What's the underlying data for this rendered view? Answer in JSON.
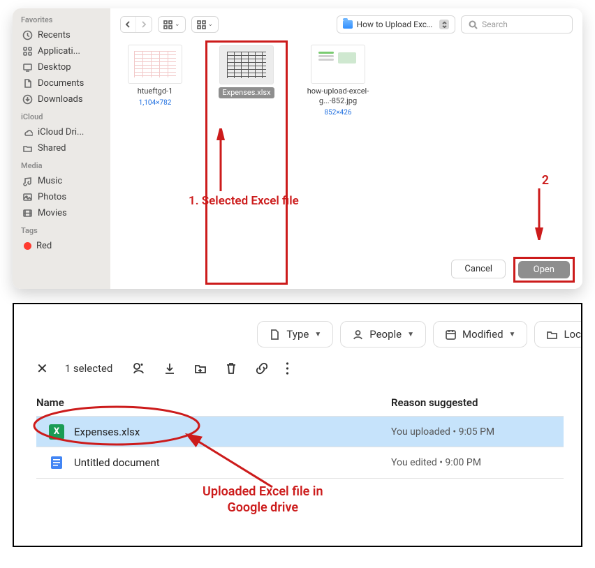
{
  "finder": {
    "sidebar": {
      "favorites_label": "Favorites",
      "items_fav": [
        {
          "icon": "clock",
          "label": "Recents"
        },
        {
          "icon": "app",
          "label": "Applicati..."
        },
        {
          "icon": "desktop",
          "label": "Desktop"
        },
        {
          "icon": "doc",
          "label": "Documents"
        },
        {
          "icon": "download",
          "label": "Downloads"
        }
      ],
      "icloud_label": "iCloud",
      "items_icloud": [
        {
          "icon": "cloud",
          "label": "iCloud Dri..."
        },
        {
          "icon": "shared",
          "label": "Shared"
        }
      ],
      "media_label": "Media",
      "items_media": [
        {
          "icon": "music",
          "label": "Music"
        },
        {
          "icon": "photo",
          "label": "Photos"
        },
        {
          "icon": "movie",
          "label": "Movies"
        }
      ],
      "tags_label": "Tags",
      "items_tags": [
        {
          "color": "#ff3b30",
          "label": "Red"
        }
      ]
    },
    "path": "How to Upload Excel to...",
    "search_placeholder": "Search",
    "files": [
      {
        "name": "htueftgd-1",
        "dim": "1,104×782",
        "kind": "doc"
      },
      {
        "name": "Expenses.xlsx",
        "kind": "xls",
        "selected": true
      },
      {
        "name": "how-upload-excel-g...-852.jpg",
        "dim": "852×426",
        "kind": "img"
      }
    ],
    "cancel": "Cancel",
    "open": "Open",
    "annotation1": "1. Selected Excel file",
    "annotation2": "2"
  },
  "drive": {
    "chips": [
      {
        "icon": "file",
        "label": "Type"
      },
      {
        "icon": "person",
        "label": "People"
      },
      {
        "icon": "calendar",
        "label": "Modified"
      },
      {
        "icon": "folder",
        "label": "Locat"
      }
    ],
    "selected_text": "1 selected",
    "col_name": "Name",
    "col_reason": "Reason suggested",
    "rows": [
      {
        "icon": "xlsx",
        "name": "Expenses.xlsx",
        "reason": "You uploaded • 9:05 PM"
      },
      {
        "icon": "gdoc",
        "name": "Untitled document",
        "reason": "You edited • 9:00 PM"
      }
    ],
    "annotation": "Uploaded Excel file in\nGoogle drive"
  }
}
